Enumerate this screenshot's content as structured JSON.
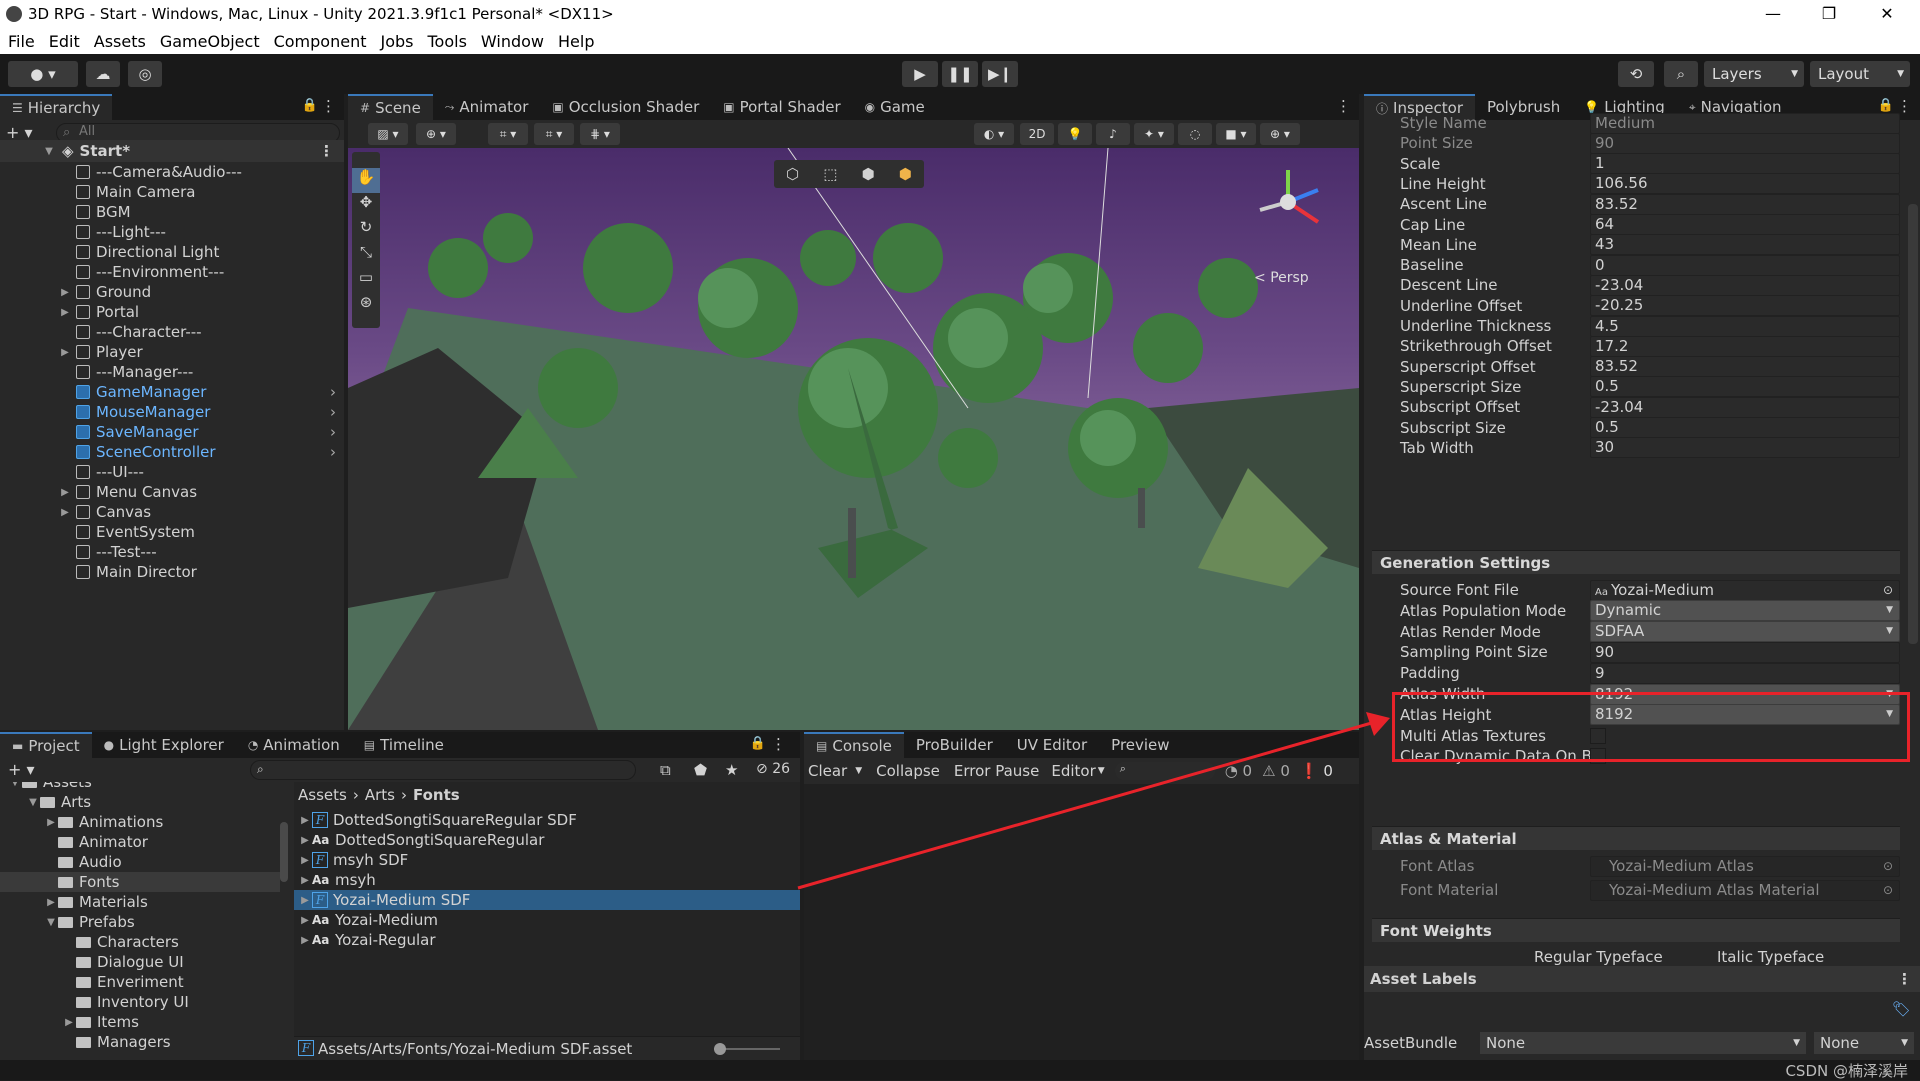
{
  "window": {
    "title": "3D RPG - Start - Windows, Mac, Linux - Unity 2021.3.9f1c1 Personal* <DX11>"
  },
  "menu": [
    "File",
    "Edit",
    "Assets",
    "GameObject",
    "Component",
    "Jobs",
    "Tools",
    "Window",
    "Help"
  ],
  "toolbar": {
    "layers": "Layers",
    "layout": "Layout"
  },
  "hierarchy": {
    "tab": "Hierarchy",
    "search_placeholder": "All",
    "scene": "Start*",
    "items": [
      {
        "label": "---Camera&Audio---",
        "foldout": false,
        "prefab": false
      },
      {
        "label": "Main Camera",
        "foldout": false,
        "prefab": false
      },
      {
        "label": "BGM",
        "foldout": false,
        "prefab": false
      },
      {
        "label": "---Light---",
        "foldout": false,
        "prefab": false
      },
      {
        "label": "Directional Light",
        "foldout": false,
        "prefab": false
      },
      {
        "label": "---Environment---",
        "foldout": false,
        "prefab": false
      },
      {
        "label": "Ground",
        "foldout": true,
        "prefab": false
      },
      {
        "label": "Portal",
        "foldout": true,
        "prefab": false
      },
      {
        "label": "---Character---",
        "foldout": false,
        "prefab": false
      },
      {
        "label": "Player",
        "foldout": true,
        "prefab": false
      },
      {
        "label": "---Manager---",
        "foldout": false,
        "prefab": false
      },
      {
        "label": "GameManager",
        "foldout": false,
        "prefab": true
      },
      {
        "label": "MouseManager",
        "foldout": false,
        "prefab": true
      },
      {
        "label": "SaveManager",
        "foldout": false,
        "prefab": true
      },
      {
        "label": "SceneController",
        "foldout": false,
        "prefab": true
      },
      {
        "label": "---UI---",
        "foldout": false,
        "prefab": false
      },
      {
        "label": "Menu Canvas",
        "foldout": true,
        "prefab": false
      },
      {
        "label": "Canvas",
        "foldout": true,
        "prefab": false
      },
      {
        "label": "EventSystem",
        "foldout": false,
        "prefab": false
      },
      {
        "label": "---Test---",
        "foldout": false,
        "prefab": false
      },
      {
        "label": "Main Director",
        "foldout": false,
        "prefab": false
      }
    ]
  },
  "scene_tabs": [
    "Scene",
    "Animator",
    "Occlusion Shader",
    "Portal Shader",
    "Game"
  ],
  "scene_view": {
    "persp": "Persp",
    "mode_2d": "2D"
  },
  "inspector": {
    "tabs": [
      "Inspector",
      "Polybrush",
      "Lighting",
      "Navigation"
    ],
    "face_info": [
      {
        "label": "Style Name",
        "value": "Medium",
        "dim": true
      },
      {
        "label": "Point Size",
        "value": "90",
        "dim": true
      },
      {
        "label": "Scale",
        "value": "1"
      },
      {
        "label": "Line Height",
        "value": "106.56"
      },
      {
        "label": "Ascent Line",
        "value": "83.52"
      },
      {
        "label": "Cap Line",
        "value": "64"
      },
      {
        "label": "Mean Line",
        "value": "43"
      },
      {
        "label": "Baseline",
        "value": "0"
      },
      {
        "label": "Descent Line",
        "value": "-23.04"
      },
      {
        "label": "Underline Offset",
        "value": "-20.25"
      },
      {
        "label": "Underline Thickness",
        "value": "4.5"
      },
      {
        "label": "Strikethrough Offset",
        "value": "17.2"
      },
      {
        "label": "Superscript Offset",
        "value": "83.52"
      },
      {
        "label": "Superscript Size",
        "value": "0.5"
      },
      {
        "label": "Subscript Offset",
        "value": "-23.04"
      },
      {
        "label": "Subscript Size",
        "value": "0.5"
      },
      {
        "label": "Tab Width",
        "value": "30"
      }
    ],
    "generation_title": "Generation Settings",
    "generation": [
      {
        "label": "Source Font File",
        "value": "Yozai-Medium",
        "type": "object"
      },
      {
        "label": "Atlas Population Mode",
        "value": "Dynamic",
        "type": "dropdown"
      },
      {
        "label": "Atlas Render Mode",
        "value": "SDFAA",
        "type": "dropdown"
      },
      {
        "label": "Sampling Point Size",
        "value": "90",
        "type": "field"
      },
      {
        "label": "Padding",
        "value": "9",
        "type": "field"
      },
      {
        "label": "Atlas Width",
        "value": "8192",
        "type": "dropdown"
      },
      {
        "label": "Atlas Height",
        "value": "8192",
        "type": "dropdown"
      },
      {
        "label": "Multi Atlas Textures",
        "value": "",
        "type": "toggle"
      },
      {
        "label": "Clear Dynamic Data On B",
        "value": "",
        "type": "toggle"
      }
    ],
    "atlas_title": "Atlas & Material",
    "atlas": [
      {
        "label": "Font Atlas",
        "value": "Yozai-Medium Atlas"
      },
      {
        "label": "Font Material",
        "value": "Yozai-Medium Atlas Material"
      }
    ],
    "weights_title": "Font Weights",
    "weights_cols": [
      "Regular Typeface",
      "Italic Typeface"
    ],
    "asset_labels": "Asset Labels",
    "assetbundle_label": "AssetBundle",
    "assetbundle_value": "None",
    "assetbundle_variant": "None"
  },
  "project": {
    "tabs": [
      "Project",
      "Light Explorer",
      "Animation",
      "Timeline"
    ],
    "hidden_count": "26",
    "tree": [
      {
        "label": "Assets",
        "depth": 0,
        "open": true
      },
      {
        "label": "Arts",
        "depth": 1,
        "open": true
      },
      {
        "label": "Animations",
        "depth": 2,
        "foldout": true
      },
      {
        "label": "Animator",
        "depth": 2
      },
      {
        "label": "Audio",
        "depth": 2
      },
      {
        "label": "Fonts",
        "depth": 2,
        "selected": true
      },
      {
        "label": "Materials",
        "depth": 2,
        "foldout": true
      },
      {
        "label": "Prefabs",
        "depth": 2,
        "open": true
      },
      {
        "label": "Characters",
        "depth": 3
      },
      {
        "label": "Dialogue UI",
        "depth": 3
      },
      {
        "label": "Enveriment",
        "depth": 3
      },
      {
        "label": "Inventory UI",
        "depth": 3
      },
      {
        "label": "Items",
        "depth": 3,
        "foldout": true
      },
      {
        "label": "Managers",
        "depth": 3
      }
    ],
    "breadcrumb": [
      "Assets",
      "Arts",
      "Fonts"
    ],
    "files": [
      {
        "label": "DottedSongtiSquareRegular SDF",
        "kind": "F"
      },
      {
        "label": "DottedSongtiSquareRegular",
        "kind": "Aa"
      },
      {
        "label": "msyh SDF",
        "kind": "F"
      },
      {
        "label": "msyh",
        "kind": "Aa"
      },
      {
        "label": "Yozai-Medium SDF",
        "kind": "F",
        "selected": true
      },
      {
        "label": "Yozai-Medium",
        "kind": "Aa"
      },
      {
        "label": "Yozai-Regular",
        "kind": "Aa"
      }
    ],
    "path": "Assets/Arts/Fonts/Yozai-Medium SDF.asset"
  },
  "console": {
    "tabs": [
      "Console",
      "ProBuilder",
      "UV Editor",
      "Preview"
    ],
    "buttons": [
      "Clear",
      "Collapse",
      "Error Pause",
      "Editor"
    ],
    "counts": {
      "log": "0",
      "warn": "0",
      "error": "0"
    }
  },
  "watermark": "CSDN @楠泽溪岸",
  "colors": {
    "accent": "#3a79bb",
    "highlight_box": "#e8232a",
    "selection": "#2c5d87"
  }
}
